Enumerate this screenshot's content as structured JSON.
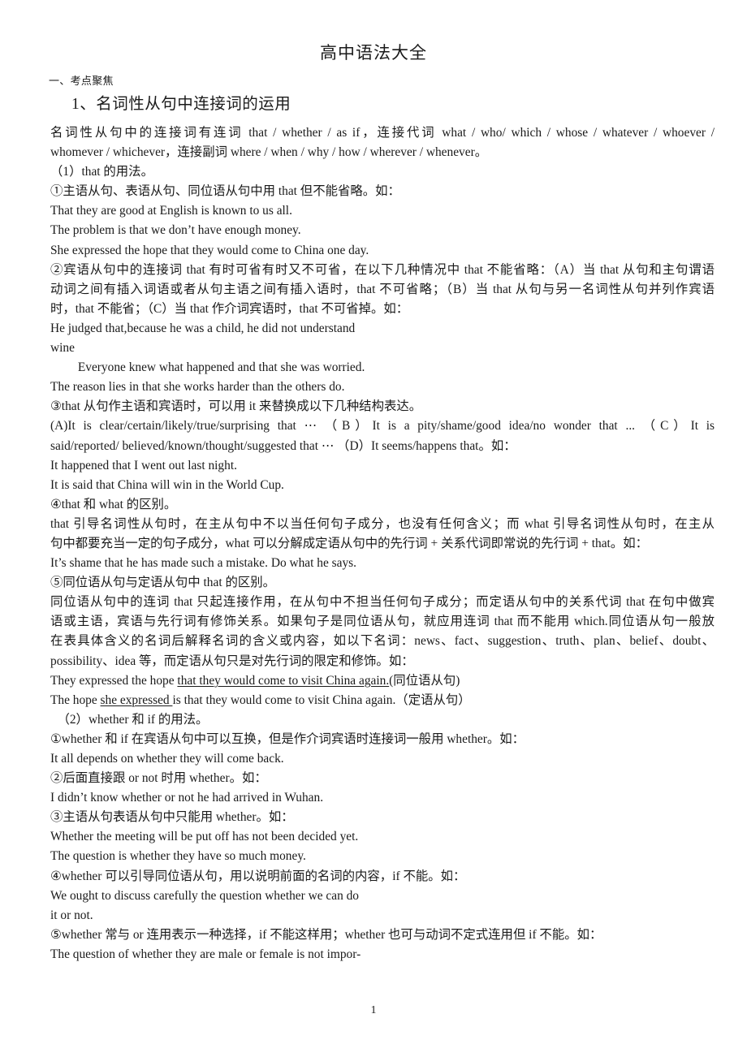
{
  "document": {
    "title": "高中语法大全",
    "section_label": "一、考点聚焦",
    "heading": "1、名词性从句中连接词的运用",
    "page_number": "1"
  },
  "lines": [
    {
      "id": "l1",
      "style": "just",
      "text": "名词性从句中的连接词有连词 that / whether / as if，连接代词 what / who/ which / whose / whatever / whoever /"
    },
    {
      "id": "l2",
      "style": "plain",
      "text": "whomever / whichever，连接副词 where / when / why / how / wherever / whenever。"
    },
    {
      "id": "l3",
      "style": "plain",
      "text": "（1）that 的用法。"
    },
    {
      "id": "l4",
      "style": "plain",
      "text": "①主语从句、表语从句、同位语从句中用 that 但不能省略。如："
    },
    {
      "id": "l5",
      "style": "plain",
      "text": "That they are good at English is known to us all."
    },
    {
      "id": "l6",
      "style": "plain",
      "text": "The problem is that we don’t have enough money."
    },
    {
      "id": "l7",
      "style": "plain",
      "text": "She expressed the hope that they would come to China one day."
    },
    {
      "id": "l8",
      "style": "just",
      "text": "②宾语从句中的连接词 that 有时可省有时又不可省，在以下几种情况中 that 不能省略：（A）当 that 从句和主句谓语"
    },
    {
      "id": "l9",
      "style": "just",
      "text": "动词之间有插入词语或者从句主语之间有插入语时，that 不可省略；（B）当 that 从句与另一名词性从句并列作宾语"
    },
    {
      "id": "l10",
      "style": "plain",
      "text": "时，that 不能省；（C）当 that 作介词宾语时，that 不可省掉。如："
    },
    {
      "id": "l11",
      "style": "plain",
      "text": "He judged that,because he was a child, he did not understand"
    },
    {
      "id": "l12",
      "style": "plain",
      "text": "wine"
    },
    {
      "id": "l13",
      "style": "indent",
      "text": "Everyone knew what happened and that she was worried."
    },
    {
      "id": "l14",
      "style": "plain",
      "text": "The reason lies in that she works harder than the others do."
    },
    {
      "id": "l15",
      "style": "plain",
      "text": "③that 从句作主语和宾语时，可以用 it 来替换成以下几种结构表达。"
    },
    {
      "id": "l16",
      "style": "just",
      "text": "(A)It is clear/certain/likely/true/surprising that ⋯ （B）It is a pity/shame/good idea/no wonder that ... （C）It is"
    },
    {
      "id": "l17",
      "style": "plain",
      "text": "said/reported/ believed/known/thought/suggested that ⋯ （D）It seems/happens that。如："
    },
    {
      "id": "l18",
      "style": "plain",
      "text": "It happened that I went out last night."
    },
    {
      "id": "l19",
      "style": "plain",
      "text": "It is said that China will win in the World Cup."
    },
    {
      "id": "l20",
      "style": "plain",
      "text": "④that 和 what 的区别。"
    },
    {
      "id": "l21",
      "style": "just",
      "text": "that  引导名词性从句时，在主从句中不以当任何句子成分，也没有任何含义；而 what 引导名词性从句时，在主从"
    },
    {
      "id": "l22",
      "style": "just-left",
      "text": "句中都要充当一定的句子成分，what 可以分解成定语从句中的先行词 + 关系代词即常说的先行词 + that。如："
    },
    {
      "id": "l23",
      "style": "plain",
      "text": "It’s shame that he has made such a mistake. Do what he says."
    },
    {
      "id": "l24",
      "style": "plain",
      "text": "⑤同位语从句与定语从句中 that 的区别。"
    },
    {
      "id": "l25",
      "style": "just",
      "text": "同位语从句中的连词 that 只起连接作用，在从句中不担当任何句子成分；而定语从句中的关系代词 that 在句中做宾"
    },
    {
      "id": "l26",
      "style": "just",
      "text": "语或主语，宾语与先行词有修饰关系。如果句子是同位语从句，就应用连词 that 而不能用 which.同位语从句一般放"
    },
    {
      "id": "l27",
      "style": "just",
      "text": "在表具体含义的名词后解释名词的含义或内容，如以下名词：news、fact、suggestion、truth、plan、belief、doubt、"
    },
    {
      "id": "l28",
      "style": "just-left",
      "text": "possibility、idea 等，而定语从句只是对先行词的限定和修饰。如："
    }
  ],
  "underlined_lines": [
    {
      "id": "l29",
      "parts": [
        {
          "text": "They expressed the hope ",
          "underline": false
        },
        {
          "text": "that they would come to visit China again.",
          "underline": true
        },
        {
          "text": "(同位语从句)",
          "underline": false
        }
      ]
    },
    {
      "id": "l30",
      "parts": [
        {
          "text": "The hope ",
          "underline": false
        },
        {
          "text": "she expressed ",
          "underline": true
        },
        {
          "text": "is that they would come to visit China again.（定语从句）",
          "underline": false
        }
      ]
    }
  ],
  "lines_tail": [
    {
      "id": "l31",
      "style": "pad1",
      "text": "（2）whether 和 if 的用法。"
    },
    {
      "id": "l32",
      "style": "plain",
      "text": "①whether 和 if 在宾语从句中可以互换，但是作介词宾语时连接词一般用 whether。如："
    },
    {
      "id": "l33",
      "style": "plain",
      "text": "It all depends on whether they will come back."
    },
    {
      "id": "l34",
      "style": "plain",
      "text": "②后面直接跟 or not  时用 whether。如："
    },
    {
      "id": "l35",
      "style": "plain",
      "text": "I didn’t know whether or not he had arrived in Wuhan."
    },
    {
      "id": "l36",
      "style": "plain",
      "text": "③主语从句表语从句中只能用 whether。如："
    },
    {
      "id": "l37",
      "style": "plain",
      "text": "Whether the meeting will be put off has not been decided yet."
    },
    {
      "id": "l38",
      "style": "plain",
      "text": "The question is whether they have so much money."
    },
    {
      "id": "l39",
      "style": "plain",
      "text": "④whether 可以引导同位语从句，用以说明前面的名词的内容，if 不能。如："
    },
    {
      "id": "l40",
      "style": "plain",
      "text": "We ought to discuss carefully the question whether we can do"
    },
    {
      "id": "l41",
      "style": "plain",
      "text": "it or not."
    },
    {
      "id": "l42",
      "style": "plain",
      "text": "⑤whether 常与 or 连用表示一种选择，if 不能这样用；whether 也可与动词不定式连用但 if 不能。如："
    },
    {
      "id": "l43",
      "style": "plain",
      "text": "The question of whether they are male or female is not impor-"
    }
  ]
}
